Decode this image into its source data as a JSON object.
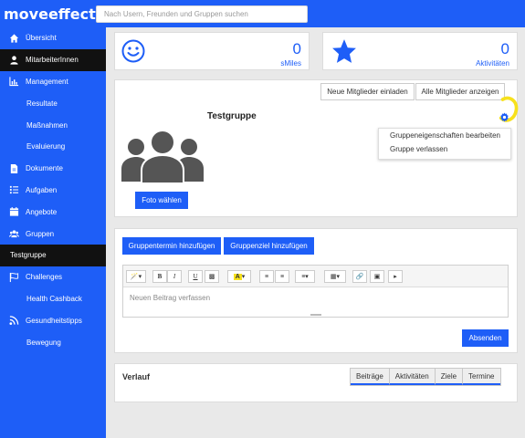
{
  "brand": {
    "part1": "move",
    "part2": "effect"
  },
  "search": {
    "placeholder": "Nach Usern, Freunden und Gruppen suchen"
  },
  "sidebar": {
    "items": [
      {
        "label": "Übersicht"
      },
      {
        "label": "MitarbeiterInnen"
      },
      {
        "label": "Management"
      },
      {
        "label": "Resultate"
      },
      {
        "label": "Maßnahmen"
      },
      {
        "label": "Evaluierung"
      },
      {
        "label": "Dokumente"
      },
      {
        "label": "Aufgaben"
      },
      {
        "label": "Angebote"
      },
      {
        "label": "Gruppen"
      },
      {
        "label": "Testgruppe"
      },
      {
        "label": "Challenges"
      },
      {
        "label": "Health Cashback"
      },
      {
        "label": "Gesundheitstipps"
      },
      {
        "label": "Bewegung"
      }
    ]
  },
  "stats": {
    "smiles": {
      "value": "0",
      "label": "sMiles"
    },
    "aktivitaeten": {
      "value": "0",
      "label": "Aktivitäten"
    }
  },
  "group": {
    "name": "Testgruppe",
    "invite_label": "Neue Mitglieder einladen",
    "show_members_label": "Alle Mitglieder anzeigen",
    "photo_button": "Foto wählen",
    "menu": [
      "Gruppeneigenschaften bearbeiten",
      "Gruppe verlassen"
    ]
  },
  "post": {
    "add_event": "Gruppentermin hinzufügen",
    "add_goal": "Gruppenziel hinzufügen",
    "placeholder": "Neuen Beitrag verfassen",
    "submit": "Absenden"
  },
  "history": {
    "title": "Verlauf",
    "tabs": [
      "Beiträge",
      "Aktivitäten",
      "Ziele",
      "Termine"
    ]
  },
  "colors": {
    "accent": "#1e5ef7",
    "highlight": "#f7e11c"
  }
}
